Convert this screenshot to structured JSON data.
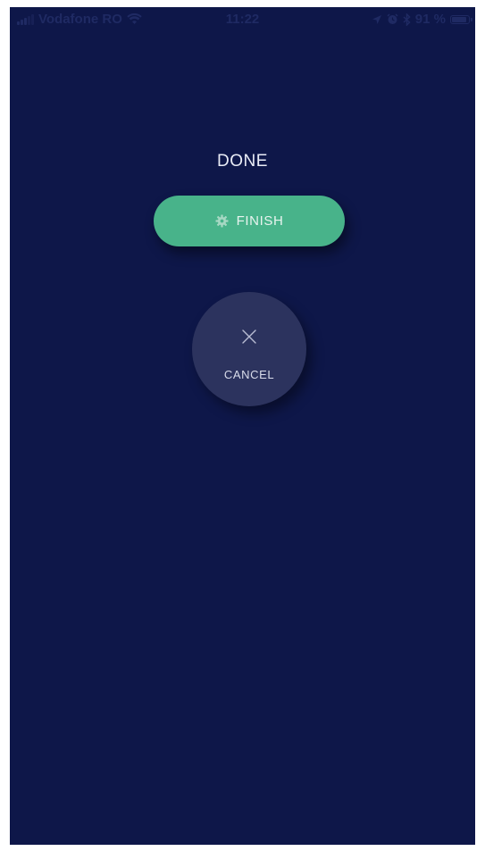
{
  "status_bar": {
    "carrier": "Vodafone RO",
    "time": "11:22",
    "battery_percent": "91 %",
    "battery_level": 0.91,
    "icons": [
      "signal-icon",
      "wifi-icon",
      "location-icon",
      "alarm-icon",
      "bluetooth-icon",
      "battery-icon"
    ]
  },
  "screen": {
    "title": "DONE",
    "background_color": "#0e1749"
  },
  "finish_button": {
    "label": "FINISH",
    "icon": "gear-icon",
    "color": "#48b38a"
  },
  "cancel_button": {
    "label": "CANCEL",
    "icon": "close-icon",
    "color": "#2c335e"
  }
}
